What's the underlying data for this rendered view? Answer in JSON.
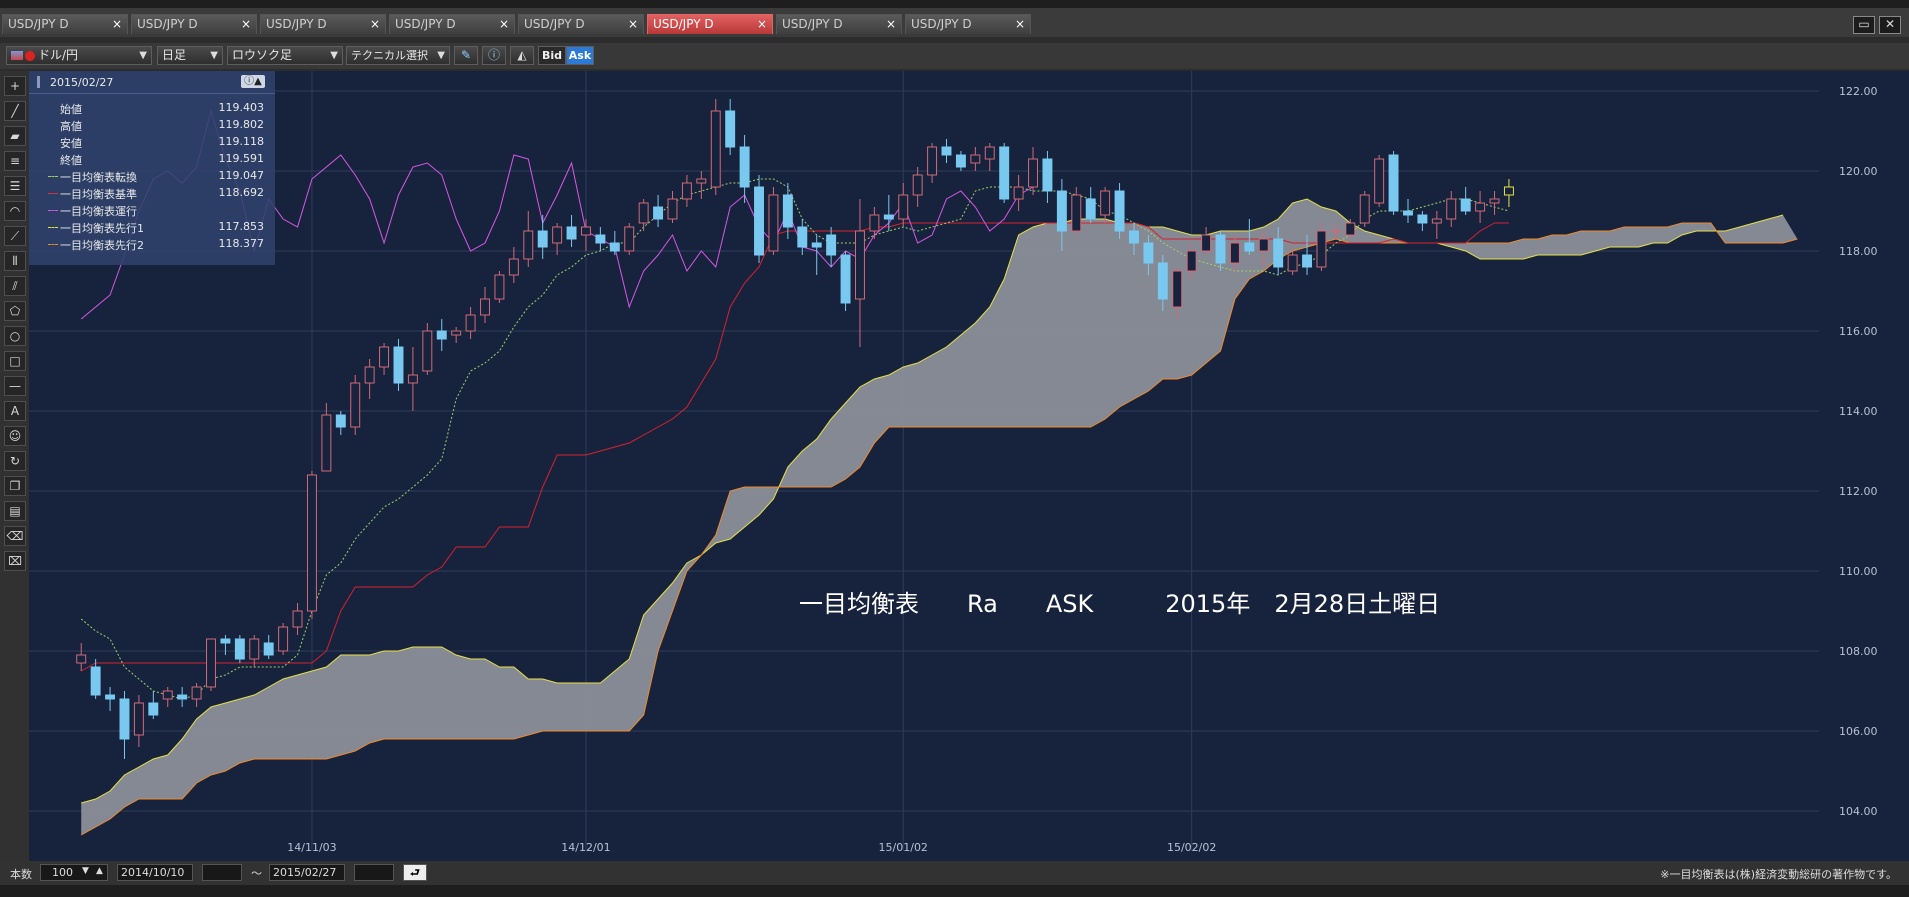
{
  "tabs": [
    {
      "label": "USD/JPY D",
      "active": false
    },
    {
      "label": "USD/JPY D",
      "active": false
    },
    {
      "label": "USD/JPY D",
      "active": false
    },
    {
      "label": "USD/JPY D",
      "active": false
    },
    {
      "label": "USD/JPY D",
      "active": false
    },
    {
      "label": "USD/JPY D",
      "active": true
    },
    {
      "label": "USD/JPY D",
      "active": false
    },
    {
      "label": "USD/JPY D",
      "active": false
    }
  ],
  "tab_close": "×",
  "toolbar": {
    "pair": "ドル/円",
    "timeframe": "日足",
    "chart_type": "ロウソク足",
    "technical": "テクニカル選択",
    "bid": "Bid",
    "ask": "Ask"
  },
  "info": {
    "date": "2015/02/27",
    "rows": [
      {
        "label": "始値",
        "value": "119.403",
        "color": ""
      },
      {
        "label": "高値",
        "value": "119.802",
        "color": ""
      },
      {
        "label": "安値",
        "value": "119.118",
        "color": ""
      },
      {
        "label": "終値",
        "value": "119.591",
        "color": ""
      },
      {
        "label": "一目均衡表転換",
        "value": "119.047",
        "color": "#9bd16b"
      },
      {
        "label": "一目均衡表基準",
        "value": "118.692",
        "color": "#e0303a"
      },
      {
        "label": "一目均衡表運行",
        "value": "",
        "color": "#d957e6"
      },
      {
        "label": "一目均衡表先行1",
        "value": "117.853",
        "color": "#e6e04a"
      },
      {
        "label": "一目均衡表先行2",
        "value": "118.377",
        "color": "#ee8a2a"
      }
    ]
  },
  "annotation": {
    "text": "一目均衡表　　Ra　　ASK　　　2015年　2月28日土曜日"
  },
  "status": {
    "count_label": "本数",
    "count_value": "100",
    "from_date": "2014/10/10",
    "separator": "〜",
    "to_date": "2015/02/27",
    "copyright": "※一目均衡表は(株)経済変動総研の著作物です。"
  },
  "chart_data": {
    "type": "candlestick",
    "yticks": [
      104,
      106,
      108,
      110,
      112,
      114,
      116,
      118,
      120,
      122
    ],
    "ylim": [
      103,
      122.5
    ],
    "ytick_labels": [
      "104.00",
      "106.00",
      "108.00",
      "110.00",
      "112.00",
      "114.00",
      "116.00",
      "118.00",
      "120.00",
      "122.00"
    ],
    "xtick_labels": [
      {
        "label": "14/11/03",
        "bar": 16
      },
      {
        "label": "14/12/01",
        "bar": 35
      },
      {
        "label": "15/01/02",
        "bar": 57
      },
      {
        "label": "15/02/02",
        "bar": 77
      }
    ],
    "x_range": [
      0,
      121
    ],
    "candles": [
      {
        "o": 107.7,
        "h": 108.2,
        "l": 107.5,
        "c": 107.9
      },
      {
        "o": 107.6,
        "h": 107.8,
        "l": 106.8,
        "c": 106.9
      },
      {
        "o": 106.9,
        "h": 107.1,
        "l": 106.5,
        "c": 106.8
      },
      {
        "o": 106.8,
        "h": 107.0,
        "l": 105.3,
        "c": 105.8
      },
      {
        "o": 105.9,
        "h": 106.9,
        "l": 105.6,
        "c": 106.7
      },
      {
        "o": 106.7,
        "h": 107.0,
        "l": 106.3,
        "c": 106.4
      },
      {
        "o": 106.8,
        "h": 107.1,
        "l": 106.6,
        "c": 107.0
      },
      {
        "o": 106.9,
        "h": 107.1,
        "l": 106.6,
        "c": 106.8
      },
      {
        "o": 106.8,
        "h": 107.2,
        "l": 106.6,
        "c": 107.1
      },
      {
        "o": 107.1,
        "h": 108.3,
        "l": 107.0,
        "c": 108.3
      },
      {
        "o": 108.3,
        "h": 108.4,
        "l": 107.9,
        "c": 108.2
      },
      {
        "o": 108.3,
        "h": 108.4,
        "l": 107.7,
        "c": 107.8
      },
      {
        "o": 107.8,
        "h": 108.4,
        "l": 107.6,
        "c": 108.3
      },
      {
        "o": 108.2,
        "h": 108.4,
        "l": 107.8,
        "c": 107.9
      },
      {
        "o": 108.0,
        "h": 108.7,
        "l": 107.9,
        "c": 108.6
      },
      {
        "o": 108.6,
        "h": 109.2,
        "l": 108.4,
        "c": 109.0
      },
      {
        "o": 109.0,
        "h": 112.5,
        "l": 108.8,
        "c": 112.4
      },
      {
        "o": 112.5,
        "h": 114.2,
        "l": 112.5,
        "c": 113.9
      },
      {
        "o": 113.9,
        "h": 114.0,
        "l": 113.4,
        "c": 113.6
      },
      {
        "o": 113.6,
        "h": 114.9,
        "l": 113.4,
        "c": 114.7
      },
      {
        "o": 114.7,
        "h": 115.3,
        "l": 114.3,
        "c": 115.1
      },
      {
        "o": 115.1,
        "h": 115.7,
        "l": 114.9,
        "c": 115.6
      },
      {
        "o": 115.6,
        "h": 115.8,
        "l": 114.5,
        "c": 114.7
      },
      {
        "o": 114.7,
        "h": 115.6,
        "l": 114.0,
        "c": 114.9
      },
      {
        "o": 115.0,
        "h": 116.2,
        "l": 114.9,
        "c": 116.0
      },
      {
        "o": 116.0,
        "h": 116.3,
        "l": 115.5,
        "c": 115.8
      },
      {
        "o": 115.9,
        "h": 116.1,
        "l": 115.7,
        "c": 116.0
      },
      {
        "o": 116.0,
        "h": 116.6,
        "l": 115.8,
        "c": 116.4
      },
      {
        "o": 116.4,
        "h": 117.1,
        "l": 116.2,
        "c": 116.8
      },
      {
        "o": 116.8,
        "h": 117.5,
        "l": 116.7,
        "c": 117.4
      },
      {
        "o": 117.4,
        "h": 118.1,
        "l": 117.2,
        "c": 117.8
      },
      {
        "o": 117.8,
        "h": 119.0,
        "l": 117.6,
        "c": 118.5
      },
      {
        "o": 118.5,
        "h": 118.9,
        "l": 117.8,
        "c": 118.1
      },
      {
        "o": 118.2,
        "h": 118.7,
        "l": 117.9,
        "c": 118.6
      },
      {
        "o": 118.6,
        "h": 118.9,
        "l": 118.1,
        "c": 118.3
      },
      {
        "o": 118.4,
        "h": 118.8,
        "l": 118.0,
        "c": 118.6
      },
      {
        "o": 118.4,
        "h": 118.6,
        "l": 118.0,
        "c": 118.2
      },
      {
        "o": 118.2,
        "h": 118.5,
        "l": 117.9,
        "c": 118.0
      },
      {
        "o": 118.0,
        "h": 118.7,
        "l": 117.9,
        "c": 118.6
      },
      {
        "o": 118.7,
        "h": 119.3,
        "l": 118.5,
        "c": 119.2
      },
      {
        "o": 119.1,
        "h": 119.4,
        "l": 118.6,
        "c": 118.8
      },
      {
        "o": 118.8,
        "h": 119.5,
        "l": 118.7,
        "c": 119.3
      },
      {
        "o": 119.3,
        "h": 119.9,
        "l": 119.1,
        "c": 119.7
      },
      {
        "o": 119.7,
        "h": 120.0,
        "l": 119.3,
        "c": 119.8
      },
      {
        "o": 119.6,
        "h": 121.8,
        "l": 119.4,
        "c": 121.5
      },
      {
        "o": 121.5,
        "h": 121.8,
        "l": 120.4,
        "c": 120.6
      },
      {
        "o": 120.6,
        "h": 120.9,
        "l": 119.2,
        "c": 119.6
      },
      {
        "o": 119.6,
        "h": 119.9,
        "l": 117.7,
        "c": 117.9
      },
      {
        "o": 118.0,
        "h": 119.6,
        "l": 117.9,
        "c": 119.4
      },
      {
        "o": 119.4,
        "h": 119.7,
        "l": 118.3,
        "c": 118.6
      },
      {
        "o": 118.6,
        "h": 118.8,
        "l": 117.9,
        "c": 118.1
      },
      {
        "o": 118.2,
        "h": 118.4,
        "l": 117.4,
        "c": 118.1
      },
      {
        "o": 118.4,
        "h": 118.6,
        "l": 117.6,
        "c": 117.9
      },
      {
        "o": 117.9,
        "h": 118.0,
        "l": 116.5,
        "c": 116.7
      },
      {
        "o": 116.8,
        "h": 119.3,
        "l": 115.6,
        "c": 118.5
      },
      {
        "o": 118.5,
        "h": 119.1,
        "l": 118.3,
        "c": 118.9
      },
      {
        "o": 118.9,
        "h": 119.4,
        "l": 118.5,
        "c": 118.8
      },
      {
        "o": 118.8,
        "h": 119.7,
        "l": 118.6,
        "c": 119.4
      },
      {
        "o": 119.4,
        "h": 120.1,
        "l": 119.1,
        "c": 119.9
      },
      {
        "o": 119.9,
        "h": 120.7,
        "l": 119.7,
        "c": 120.6
      },
      {
        "o": 120.6,
        "h": 120.8,
        "l": 120.2,
        "c": 120.4
      },
      {
        "o": 120.4,
        "h": 120.5,
        "l": 120.0,
        "c": 120.1
      },
      {
        "o": 120.2,
        "h": 120.6,
        "l": 120.0,
        "c": 120.4
      },
      {
        "o": 120.3,
        "h": 120.7,
        "l": 120.0,
        "c": 120.6
      },
      {
        "o": 120.6,
        "h": 120.7,
        "l": 119.2,
        "c": 119.3
      },
      {
        "o": 119.3,
        "h": 119.9,
        "l": 119.0,
        "c": 119.6
      },
      {
        "o": 119.6,
        "h": 120.6,
        "l": 119.4,
        "c": 120.3
      },
      {
        "o": 120.3,
        "h": 120.5,
        "l": 119.2,
        "c": 119.5
      },
      {
        "o": 119.5,
        "h": 119.8,
        "l": 118.0,
        "c": 118.5
      },
      {
        "o": 118.5,
        "h": 119.6,
        "l": 118.4,
        "c": 119.4
      },
      {
        "o": 119.3,
        "h": 119.6,
        "l": 118.7,
        "c": 118.8
      },
      {
        "o": 118.9,
        "h": 119.6,
        "l": 118.7,
        "c": 119.5
      },
      {
        "o": 119.5,
        "h": 119.7,
        "l": 118.3,
        "c": 118.5
      },
      {
        "o": 118.5,
        "h": 118.7,
        "l": 117.9,
        "c": 118.2
      },
      {
        "o": 118.2,
        "h": 118.4,
        "l": 117.4,
        "c": 117.7
      },
      {
        "o": 117.7,
        "h": 117.9,
        "l": 116.5,
        "c": 116.8
      },
      {
        "o": 116.6,
        "h": 117.6,
        "l": 116.3,
        "c": 117.5
      },
      {
        "o": 117.5,
        "h": 118.2,
        "l": 117.3,
        "c": 118.0
      },
      {
        "o": 118.0,
        "h": 118.6,
        "l": 117.9,
        "c": 118.4
      },
      {
        "o": 118.4,
        "h": 118.5,
        "l": 117.5,
        "c": 117.7
      },
      {
        "o": 117.7,
        "h": 118.4,
        "l": 117.5,
        "c": 118.2
      },
      {
        "o": 118.2,
        "h": 118.8,
        "l": 117.9,
        "c": 118.0
      },
      {
        "o": 118.0,
        "h": 118.5,
        "l": 117.6,
        "c": 118.3
      },
      {
        "o": 118.3,
        "h": 118.6,
        "l": 117.4,
        "c": 117.6
      },
      {
        "o": 117.5,
        "h": 118.1,
        "l": 117.4,
        "c": 117.9
      },
      {
        "o": 117.9,
        "h": 118.4,
        "l": 117.4,
        "c": 117.6
      },
      {
        "o": 117.6,
        "h": 118.7,
        "l": 117.5,
        "c": 118.5
      },
      {
        "o": 118.5,
        "h": 118.7,
        "l": 118.3,
        "c": 118.5
      },
      {
        "o": 118.4,
        "h": 118.8,
        "l": 118.3,
        "c": 118.7
      },
      {
        "o": 118.7,
        "h": 119.5,
        "l": 118.6,
        "c": 119.4
      },
      {
        "o": 119.2,
        "h": 120.4,
        "l": 119.1,
        "c": 120.3
      },
      {
        "o": 120.4,
        "h": 120.5,
        "l": 118.9,
        "c": 119.0
      },
      {
        "o": 119.0,
        "h": 119.3,
        "l": 118.7,
        "c": 118.9
      },
      {
        "o": 118.9,
        "h": 119.0,
        "l": 118.5,
        "c": 118.7
      },
      {
        "o": 118.7,
        "h": 119.0,
        "l": 118.3,
        "c": 118.8
      },
      {
        "o": 118.8,
        "h": 119.5,
        "l": 118.6,
        "c": 119.3
      },
      {
        "o": 119.3,
        "h": 119.6,
        "l": 118.9,
        "c": 119.0
      },
      {
        "o": 119.0,
        "h": 119.5,
        "l": 118.7,
        "c": 119.2
      },
      {
        "o": 119.2,
        "h": 119.5,
        "l": 118.9,
        "c": 119.3
      },
      {
        "o": 119.4,
        "h": 119.8,
        "l": 119.1,
        "c": 119.6
      }
    ],
    "tenkan": [
      108.8,
      108.5,
      108.3,
      107.6,
      107.3,
      107.0,
      106.9,
      106.8,
      106.9,
      107.3,
      107.4,
      107.6,
      107.6,
      107.6,
      107.6,
      107.9,
      109.0,
      109.9,
      110.2,
      110.8,
      111.2,
      111.6,
      111.8,
      112.1,
      112.4,
      112.8,
      114.3,
      115.0,
      115.2,
      115.5,
      116.1,
      116.6,
      116.9,
      117.4,
      117.6,
      117.9,
      118.0,
      118.2,
      118.2,
      118.6,
      118.9,
      119.2,
      119.4,
      119.5,
      119.6,
      119.7,
      119.7,
      119.8,
      119.8,
      119.6,
      118.8,
      118.4,
      118.2,
      118.2,
      118.2,
      118.4,
      118.5,
      118.6,
      118.5,
      118.6,
      118.7,
      118.8,
      119.5,
      119.6,
      119.6,
      119.6,
      119.5,
      119.5,
      119.5,
      119.4,
      119.3,
      119.0,
      118.9,
      118.7,
      118.5,
      118.2,
      118.0,
      117.8,
      117.7,
      117.6,
      117.5,
      117.5,
      117.5,
      117.4,
      117.6,
      117.7,
      117.9,
      118.2,
      118.4,
      118.8,
      119.0,
      119.0,
      119.0,
      119.1,
      119.2,
      119.3,
      119.3,
      119.2,
      119.1,
      119.0
    ],
    "kijun": [
      107.5,
      107.7,
      107.7,
      107.7,
      107.7,
      107.7,
      107.7,
      107.7,
      107.7,
      107.7,
      107.7,
      107.7,
      107.7,
      107.7,
      107.7,
      107.7,
      107.7,
      108.0,
      109.0,
      109.6,
      109.6,
      109.6,
      109.6,
      109.6,
      109.9,
      110.1,
      110.6,
      110.6,
      110.6,
      111.1,
      111.1,
      111.1,
      112.1,
      112.9,
      112.9,
      112.9,
      113.0,
      113.1,
      113.2,
      113.4,
      113.6,
      113.8,
      114.1,
      114.7,
      115.3,
      116.6,
      117.2,
      117.6,
      118.4,
      118.5,
      118.5,
      118.5,
      118.5,
      118.5,
      118.5,
      118.6,
      118.6,
      118.7,
      118.7,
      118.7,
      118.7,
      118.7,
      118.7,
      118.7,
      118.7,
      118.7,
      118.7,
      118.7,
      118.7,
      118.7,
      118.7,
      118.7,
      118.7,
      118.7,
      118.6,
      118.3,
      118.3,
      118.3,
      118.3,
      118.3,
      118.3,
      118.3,
      118.3,
      118.3,
      118.2,
      118.2,
      118.2,
      118.2,
      118.2,
      118.2,
      118.2,
      118.3,
      118.2,
      118.2,
      118.2,
      118.2,
      118.2,
      118.5,
      118.7,
      118.7
    ],
    "chikou": [
      116.3,
      116.6,
      116.9,
      117.9,
      119.0,
      119.8,
      120.0,
      119.7,
      120.1,
      121.5,
      120.3,
      119.5,
      118.0,
      119.3,
      118.8,
      118.6,
      119.8,
      120.1,
      120.4,
      119.9,
      119.3,
      118.2,
      119.4,
      120.1,
      120.2,
      119.9,
      118.8,
      118.0,
      118.2,
      119.0,
      120.4,
      120.3,
      118.7,
      119.4,
      120.2,
      118.5,
      118.3,
      118.1,
      116.6,
      117.5,
      117.9,
      118.4,
      117.5,
      118.0,
      117.6,
      119.1,
      119.4,
      118.6,
      118.2,
      119.0,
      118.1,
      118.0,
      117.6,
      118.0,
      117.8,
      118.4,
      118.7,
      119.2,
      118.2,
      118.4,
      119.3,
      119.5,
      119.1,
      118.5,
      118.8,
      119.4,
      119.6
    ],
    "senkou_a": [
      104.2,
      104.3,
      104.5,
      104.9,
      105.1,
      105.3,
      105.4,
      105.8,
      106.3,
      106.6,
      106.7,
      106.8,
      106.9,
      107.1,
      107.3,
      107.4,
      107.5,
      107.6,
      107.9,
      107.9,
      107.9,
      108.0,
      108.0,
      108.1,
      108.1,
      108.1,
      107.9,
      107.8,
      107.8,
      107.6,
      107.6,
      107.3,
      107.3,
      107.2,
      107.2,
      107.2,
      107.2,
      107.5,
      107.8,
      108.9,
      109.3,
      109.7,
      110.2,
      110.4,
      110.7,
      110.8,
      111.1,
      111.4,
      111.8,
      112.6,
      113.0,
      113.3,
      113.8,
      114.2,
      114.6,
      114.8,
      114.9,
      115.1,
      115.2,
      115.4,
      115.6,
      115.9,
      116.2,
      116.6,
      117.3,
      118.4,
      118.6,
      118.7,
      118.7,
      118.8,
      118.8,
      118.8,
      118.7,
      118.7,
      118.6,
      118.6,
      118.5,
      118.4,
      118.4,
      118.5,
      118.5,
      118.5,
      118.6,
      118.8,
      119.2,
      119.3,
      119.1,
      119.0,
      118.7,
      118.5,
      118.4,
      118.3,
      118.2,
      118.2,
      118.2,
      118.1,
      118.0,
      117.8,
      117.8,
      117.8,
      117.8,
      117.9,
      117.9,
      117.9,
      117.9,
      118.0,
      118.1,
      118.1,
      118.1,
      118.2,
      118.2,
      118.4,
      118.5,
      118.5,
      118.5,
      118.6,
      118.7,
      118.8,
      118.9
    ],
    "senkou_b": [
      103.4,
      103.6,
      103.8,
      104.1,
      104.3,
      104.3,
      104.3,
      104.3,
      104.7,
      104.9,
      105.0,
      105.2,
      105.3,
      105.3,
      105.3,
      105.3,
      105.3,
      105.3,
      105.4,
      105.5,
      105.7,
      105.8,
      105.8,
      105.8,
      105.8,
      105.8,
      105.8,
      105.8,
      105.8,
      105.8,
      105.8,
      105.9,
      106.0,
      106.0,
      106.0,
      106.0,
      106.0,
      106.0,
      106.0,
      106.4,
      108.0,
      109.0,
      110.0,
      110.4,
      110.9,
      112.0,
      112.1,
      112.1,
      112.1,
      112.1,
      112.1,
      112.1,
      112.1,
      112.3,
      112.6,
      113.2,
      113.6,
      113.6,
      113.6,
      113.6,
      113.6,
      113.6,
      113.6,
      113.6,
      113.6,
      113.6,
      113.6,
      113.6,
      113.6,
      113.6,
      113.6,
      113.8,
      114.1,
      114.3,
      114.5,
      114.8,
      114.8,
      114.9,
      115.2,
      115.5,
      116.8,
      117.3,
      117.5,
      117.8,
      118.0,
      118.1,
      118.2,
      118.3,
      118.2,
      118.2,
      118.2,
      118.2,
      118.2,
      118.2,
      118.2,
      118.2,
      118.2,
      118.2,
      118.2,
      118.2,
      118.3,
      118.3,
      118.4,
      118.4,
      118.5,
      118.5,
      118.5,
      118.6,
      118.6,
      118.6,
      118.6,
      118.7,
      118.7,
      118.7,
      118.2,
      118.2,
      118.2,
      118.2,
      118.2,
      118.3
    ]
  }
}
